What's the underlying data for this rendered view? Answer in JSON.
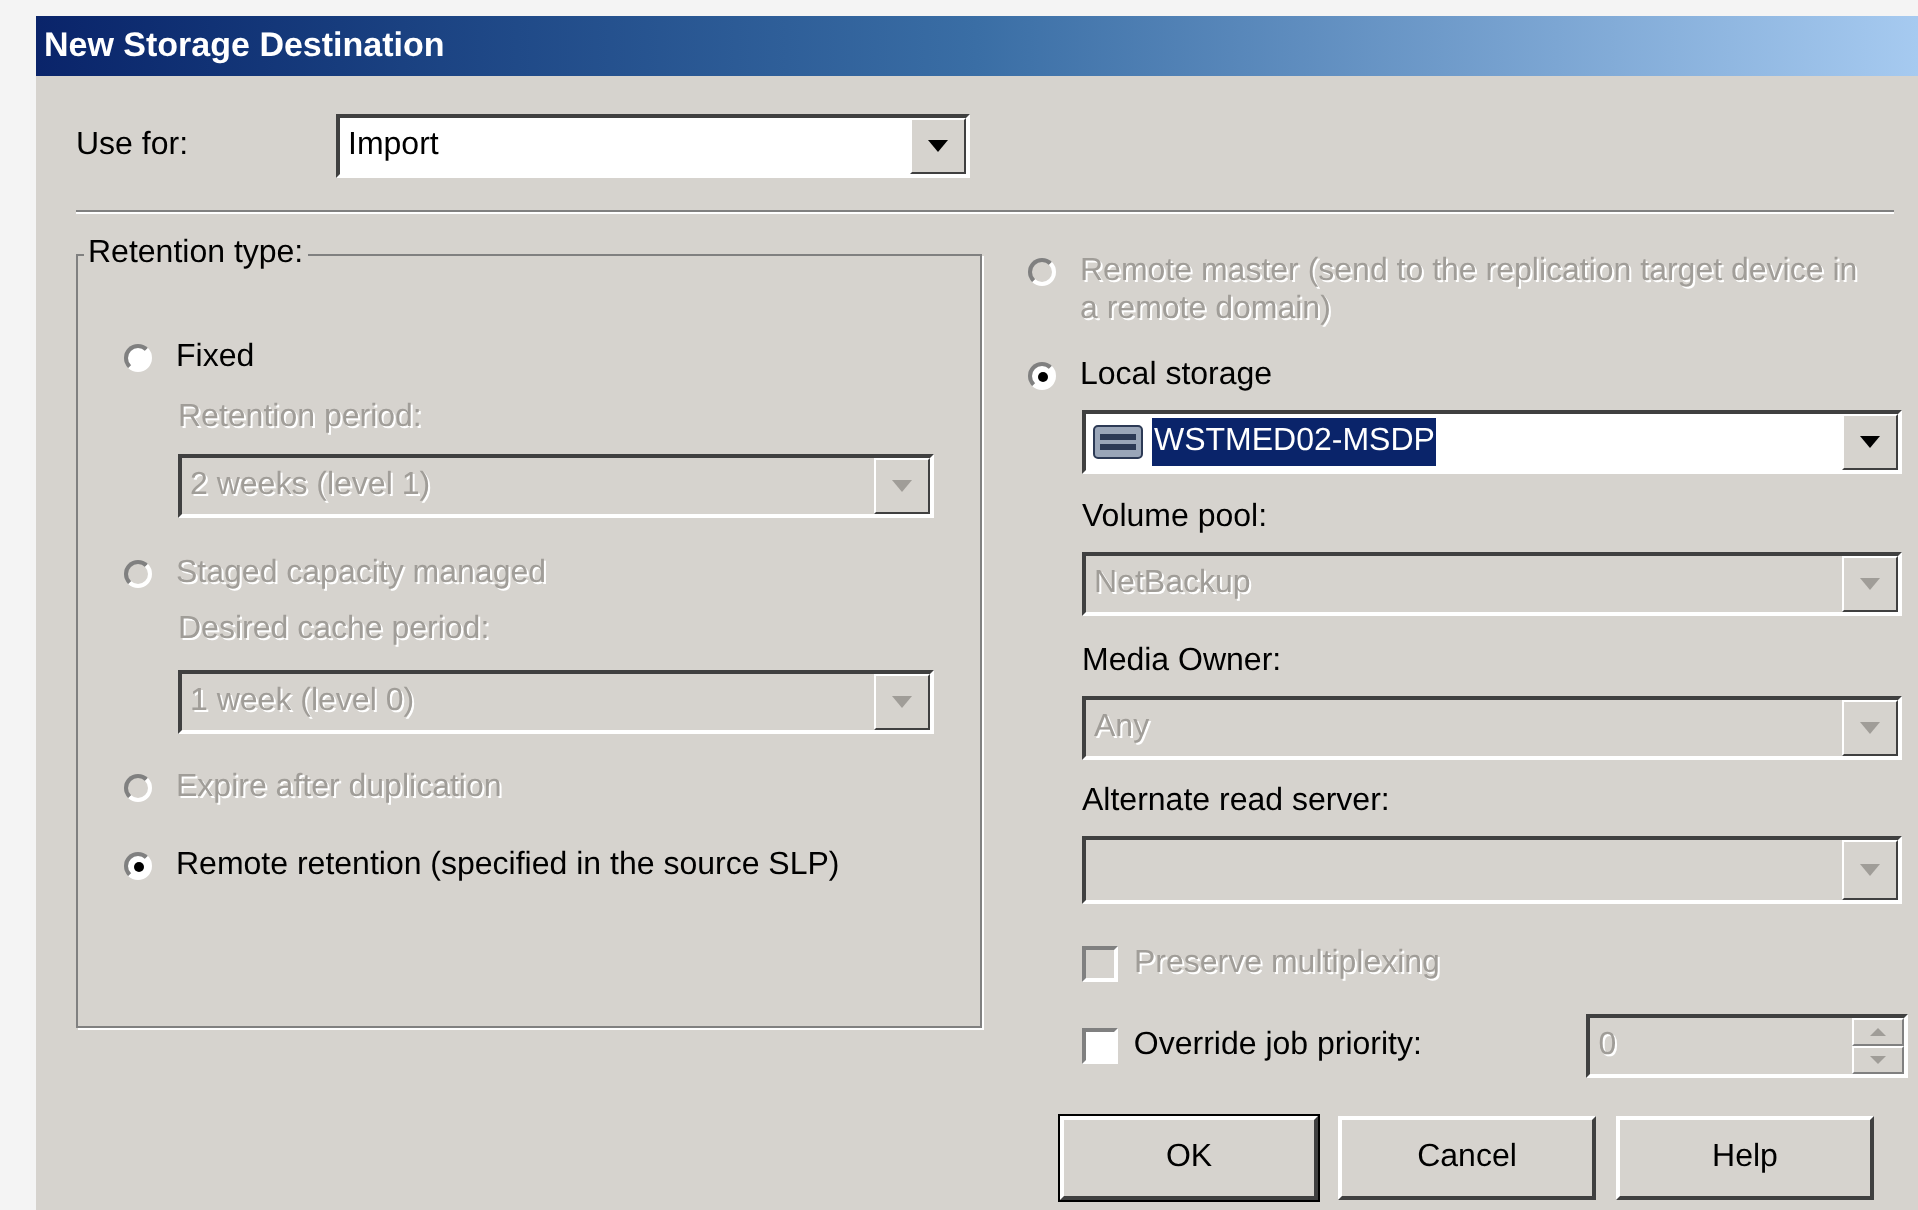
{
  "window": {
    "title": "New Storage Destination"
  },
  "use_for": {
    "label": "Use for:",
    "value": "Import"
  },
  "retention_type": {
    "title": "Retention type:",
    "options": [
      {
        "label": "Fixed",
        "selected": false,
        "disabled": false,
        "field": {
          "label": "Retention period:",
          "value": "2 weeks (level 1)",
          "disabled": true
        }
      },
      {
        "label": "Staged capacity managed",
        "selected": false,
        "disabled": true,
        "field": {
          "label": "Desired cache period:",
          "value": "1 week (level 0)",
          "disabled": true
        }
      },
      {
        "label": "Expire after duplication",
        "selected": false,
        "disabled": true
      },
      {
        "label": "Remote retention (specified in the source SLP)",
        "selected": true,
        "disabled": false
      }
    ]
  },
  "destination": {
    "options": [
      {
        "label": "Remote master (send to the replication target device in a remote domain)",
        "selected": false,
        "disabled": true
      },
      {
        "label": "Local storage",
        "selected": true,
        "disabled": false,
        "value": "WSTMED02-MSDP"
      }
    ]
  },
  "fields": [
    {
      "label": "Volume pool:",
      "value": "NetBackup",
      "disabled": true
    },
    {
      "label": "Media Owner:",
      "value": "Any",
      "disabled": true
    },
    {
      "label": "Alternate read server:",
      "disabled": true
    }
  ],
  "checkboxes": [
    {
      "label": "Preserve multiplexing",
      "checked": false,
      "disabled": true
    },
    {
      "label": "Override job priority:",
      "checked": false,
      "disabled": false,
      "spin": {
        "value": "0",
        "disabled": true
      }
    }
  ],
  "buttons": [
    {
      "label": "OK",
      "default": true
    },
    {
      "label": "Cancel",
      "default": false
    },
    {
      "label": "Help",
      "default": false
    }
  ]
}
